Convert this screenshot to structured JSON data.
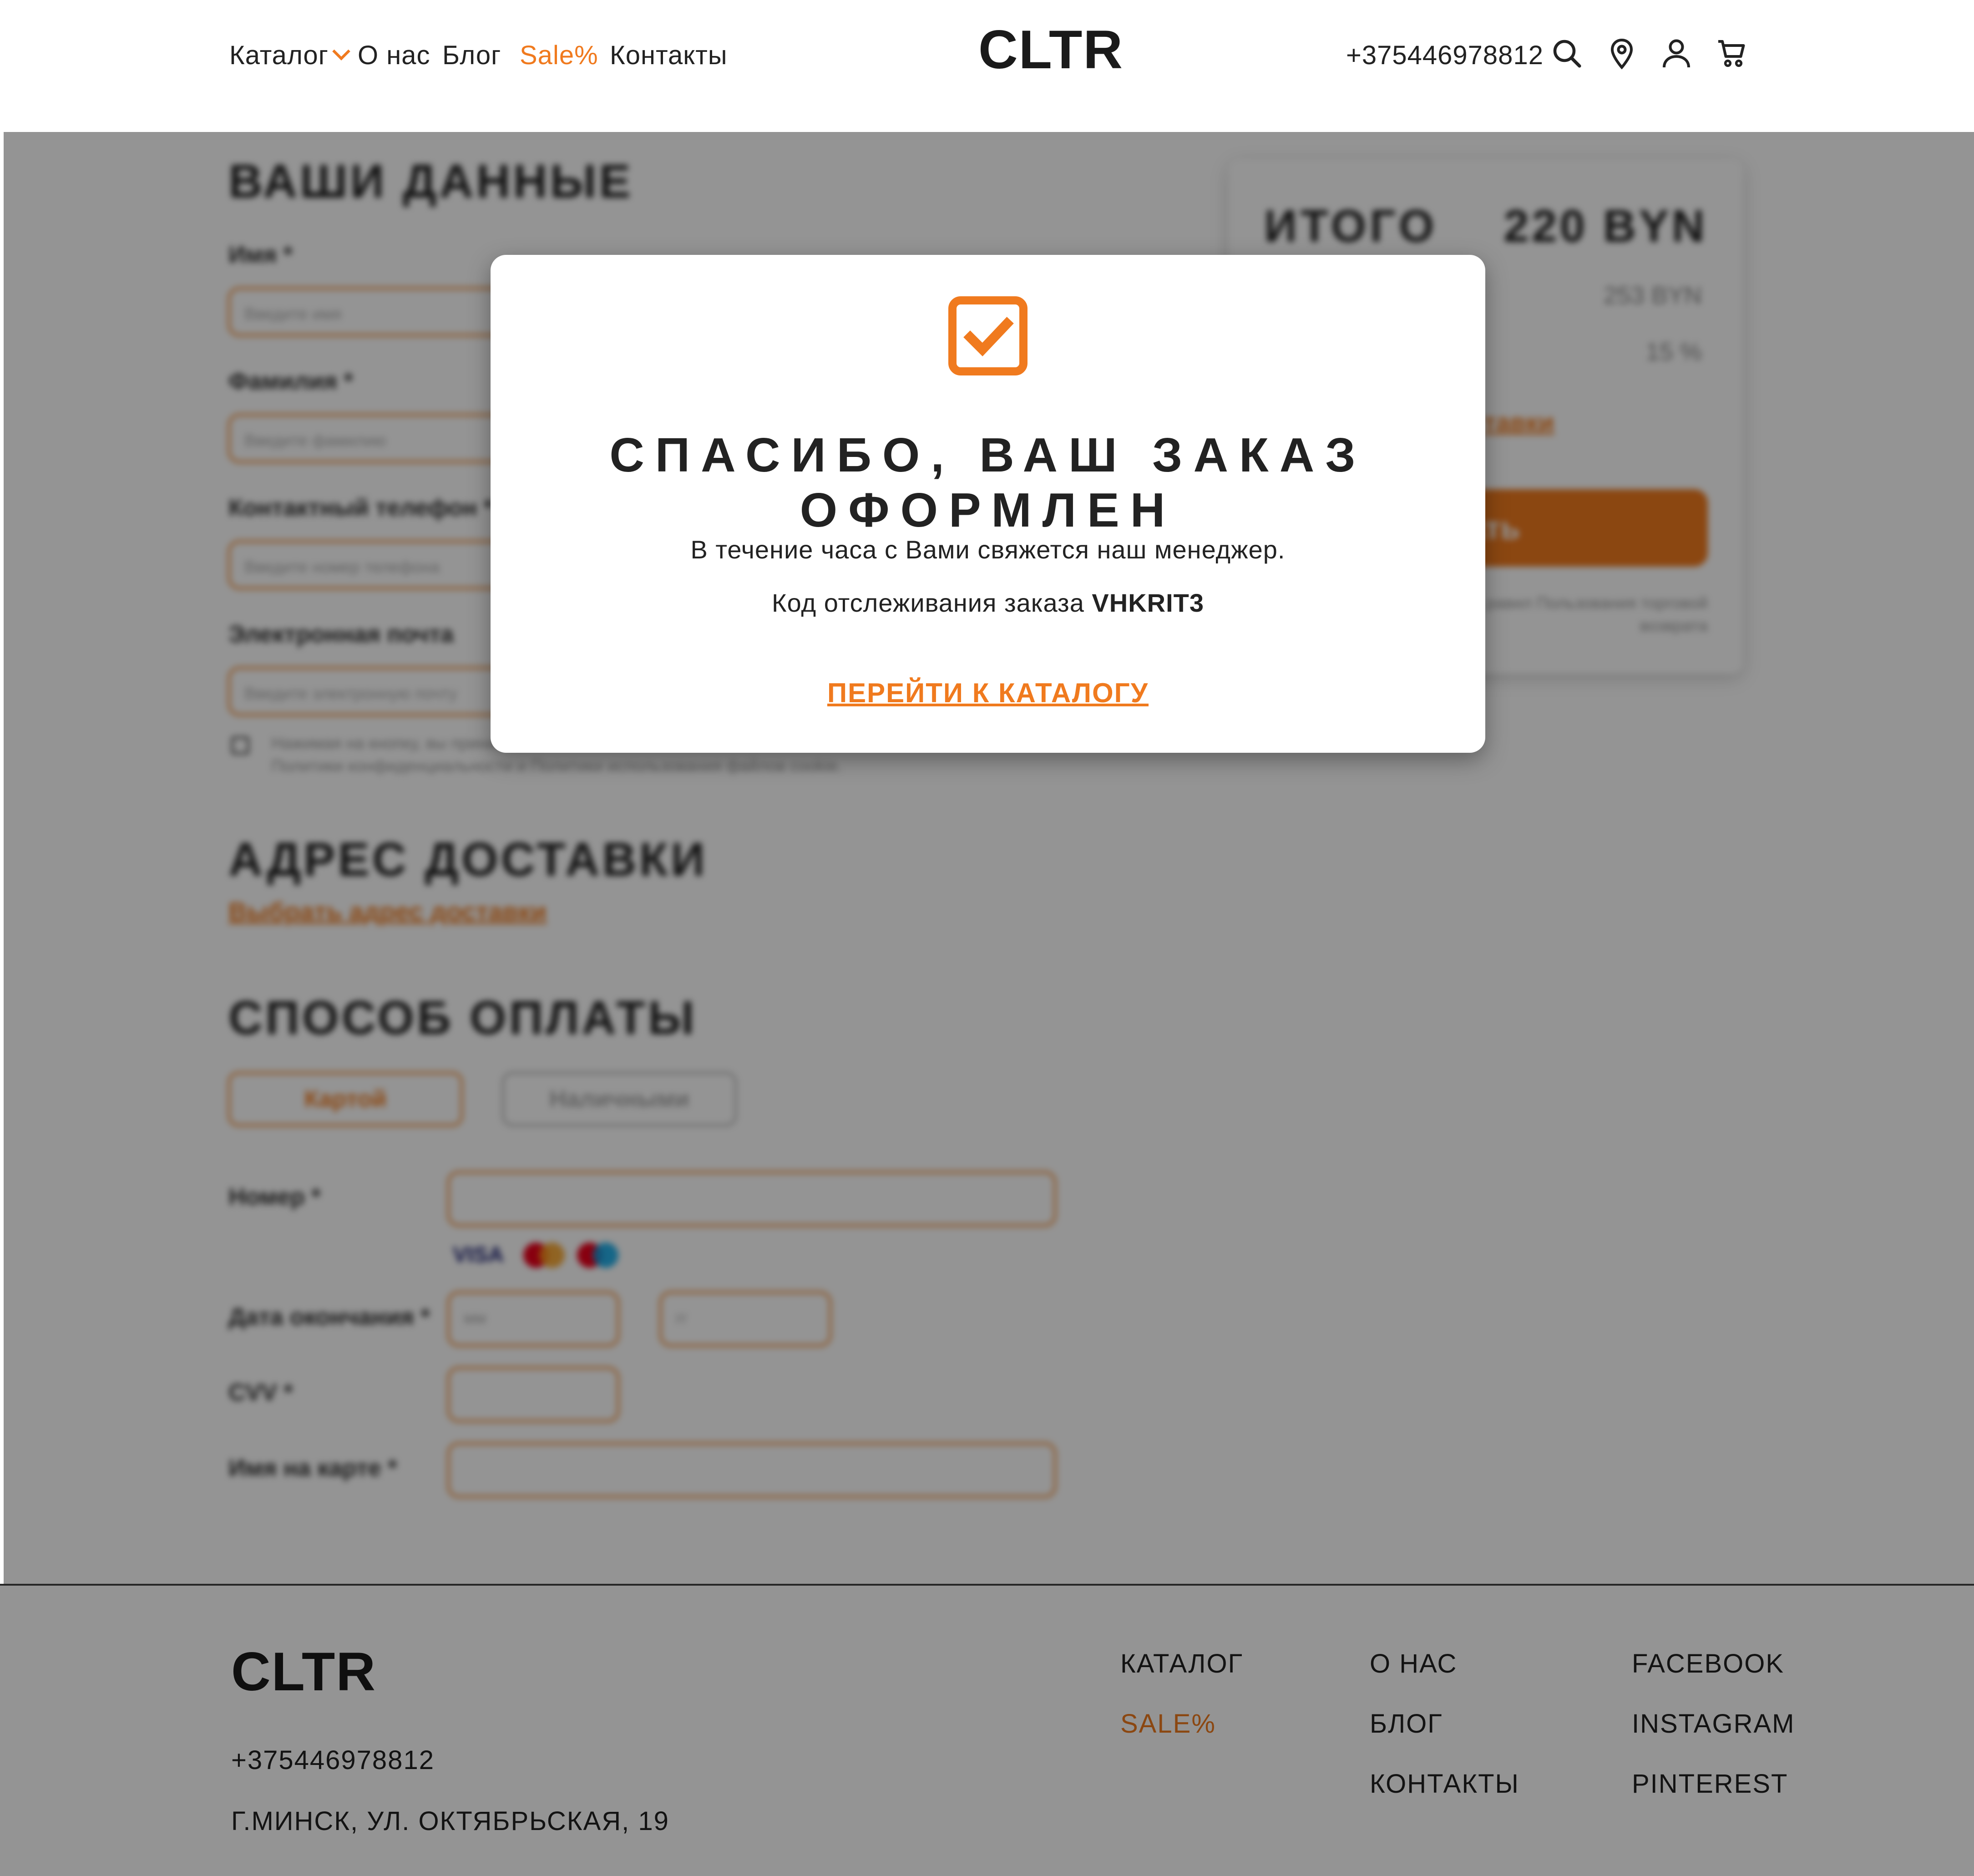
{
  "header": {
    "nav": [
      {
        "label": "Каталог"
      },
      {
        "label": "О нас"
      },
      {
        "label": "Блог"
      },
      {
        "label": "Sale%"
      },
      {
        "label": "Контакты"
      }
    ],
    "logo": "CLTR",
    "phone": "+375446978812",
    "icons": [
      "search-icon",
      "location-icon",
      "user-icon",
      "cart-icon"
    ]
  },
  "form": {
    "title": "ВАШИ ДАННЫЕ",
    "fields": [
      {
        "label": "Имя *",
        "placeholder": "Введите имя"
      },
      {
        "label": "Фамилия *",
        "placeholder": "Введите фамилию"
      },
      {
        "label": "Контактный телефон *",
        "placeholder": "Введите номер телефона"
      },
      {
        "label": "Электронная почта",
        "placeholder": "Введите электронную почту"
      }
    ],
    "consent_line1": "Нажимая на кнопку, вы принимаете",
    "consent_line2": "Политики конфиденциальности и Политики использования файлов cookie."
  },
  "delivery": {
    "title": "АДРЕС ДОСТАВКИ",
    "link": "Выбрать адрес доставки"
  },
  "payment": {
    "title": "СПОСОБ ОПЛАТЫ",
    "methods": [
      "Картой",
      "Наличными"
    ],
    "fields": [
      {
        "label": "Номер *"
      },
      {
        "label": "Дата окончания *",
        "placeholder_month": "мм",
        "placeholder_year": "гг"
      },
      {
        "label": "CVV *"
      },
      {
        "label": "Имя на карте *"
      }
    ],
    "card_brand": "VISA"
  },
  "summary": {
    "title": "ИТОГО",
    "total": "220 BYN",
    "subtotal": "253 BYN",
    "discount": "15 %",
    "delivery_link": "тавки",
    "button": "зать",
    "note_line1": "равил Пользования торговой",
    "note_line2": "возврата"
  },
  "modal": {
    "icon": "checked-box-icon",
    "title": "СПАСИБО, ВАШ ЗАКАЗ ОФОРМЛЕН",
    "message": "В течение часа с Вами свяжется наш менеджер.",
    "code_label": "Код отслеживания заказа",
    "code": "VHKRIT3",
    "link": "ПЕРЕЙТИ К КАТАЛОГУ"
  },
  "footer": {
    "logo": "CLTR",
    "phone": "+375446978812",
    "address": "Г.МИНСК, УЛ. ОКТЯБРЬСКАЯ, 19",
    "col1": [
      "КАТАЛОГ",
      "SALE%"
    ],
    "col2": [
      "О НАС",
      "БЛОГ",
      "КОНТАКТЫ"
    ],
    "col3": [
      "FACEBOOK",
      "INSTAGRAM",
      "PINTEREST"
    ]
  },
  "colors": {
    "accent": "#f07a1e",
    "overlay": "rgba(0,0,0,0.42)",
    "text": "#222222"
  }
}
